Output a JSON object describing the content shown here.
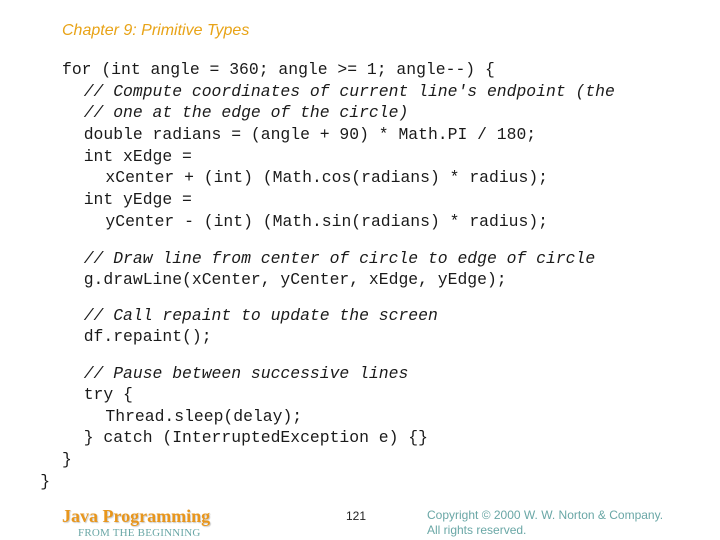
{
  "slide": {
    "title": "Chapter 9: Primitive Types"
  },
  "code": {
    "lines": [
      {
        "text": "for (int angle = 360; angle >= 1; angle--) {",
        "indent": 0,
        "comment": false
      },
      {
        "text": "// Compute coordinates of current line's endpoint (the",
        "indent": 1,
        "comment": true
      },
      {
        "text": "// one at the edge of the circle)",
        "indent": 1,
        "comment": true
      },
      {
        "text": "double radians = (angle + 90) * Math.PI / 180;",
        "indent": 1,
        "comment": false
      },
      {
        "text": "int xEdge =",
        "indent": 1,
        "comment": false
      },
      {
        "text": "xCenter + (int) (Math.cos(radians) * radius);",
        "indent": 2,
        "comment": false
      },
      {
        "text": "int yEdge =",
        "indent": 1,
        "comment": false
      },
      {
        "text": "yCenter - (int) (Math.sin(radians) * radius);",
        "indent": 2,
        "comment": false
      },
      {
        "text": "// Draw line from center of circle to edge of circle",
        "indent": 1,
        "comment": true
      },
      {
        "text": "g.drawLine(xCenter, yCenter, xEdge, yEdge);",
        "indent": 1,
        "comment": false
      },
      {
        "text": "// Call repaint to update the screen",
        "indent": 1,
        "comment": true
      },
      {
        "text": "df.repaint();",
        "indent": 1,
        "comment": false
      },
      {
        "text": "// Pause between successive lines",
        "indent": 1,
        "comment": true
      },
      {
        "text": "try {",
        "indent": 1,
        "comment": false
      },
      {
        "text": "Thread.sleep(delay);",
        "indent": 2,
        "comment": false
      },
      {
        "text": "} catch (InterruptedException e) {}",
        "indent": 1,
        "comment": false
      },
      {
        "text": "}",
        "indent": 0,
        "comment": false
      },
      {
        "text": "}",
        "indent": -1,
        "comment": false
      }
    ]
  },
  "footer": {
    "logo_title": "Java Programming",
    "logo_subtitle": "FROM THE BEGINNING",
    "page_number": "121",
    "copyright_line1": "Copyright © 2000 W. W. Norton & Company.",
    "copyright_line2": "All rights reserved."
  },
  "colors": {
    "title": "#e8a317",
    "logo": "#e8961c",
    "footer_text": "#6aa7a6"
  }
}
